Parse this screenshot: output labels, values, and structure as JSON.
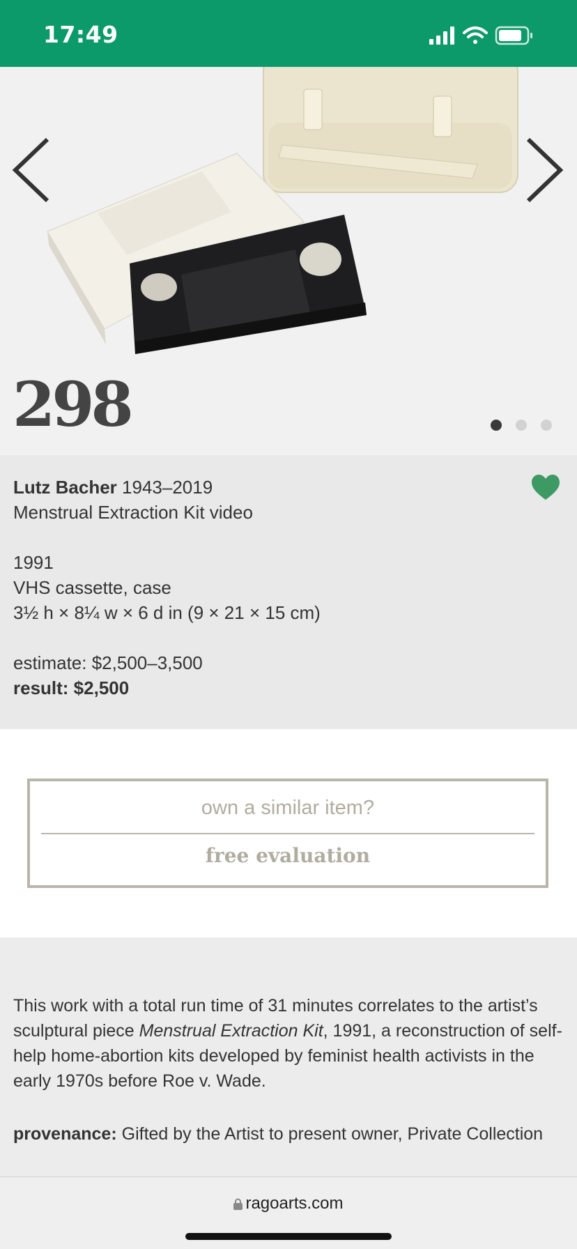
{
  "status_bar": {
    "time": "17:49",
    "icons": [
      "signal-icon",
      "wifi-icon",
      "battery-icon"
    ]
  },
  "gallery": {
    "lot_number": "298",
    "image": "vhs-cassette-and-case-photo",
    "dots_total": 3,
    "active_dot": 1
  },
  "lot": {
    "artist": "Lutz Bacher",
    "artist_dates": "1943–2019",
    "title": "Menstrual Extraction Kit video",
    "year": "1991",
    "medium": "VHS cassette, case",
    "dimensions": "3½ h × 8¼ w × 6 d in (9 × 21 × 15 cm)",
    "estimate": "estimate: $2,500–3,500",
    "result": "result: $2,500",
    "favorited": true
  },
  "evaluation": {
    "question": "own a similar item?",
    "button_label": "free evaluation"
  },
  "description": {
    "text_before": "This work with a total run time of 31 minutes correlates to the artist’s sculptural piece ",
    "text_italic": "Menstrual Extraction Kit",
    "text_after": ", 1991, a reconstruction of self-help home-abortion kits developed by feminist health activists in the early 1970s before Roe v. Wade.",
    "provenance_label": "provenance:",
    "provenance_text": " Gifted by the Artist to present owner, Private Collection"
  },
  "browser": {
    "url": "ragoarts.com"
  },
  "colors": {
    "status_bar": "#0d9a6a",
    "heart": "#3e9a63",
    "eval_border": "#b9b5aa"
  }
}
